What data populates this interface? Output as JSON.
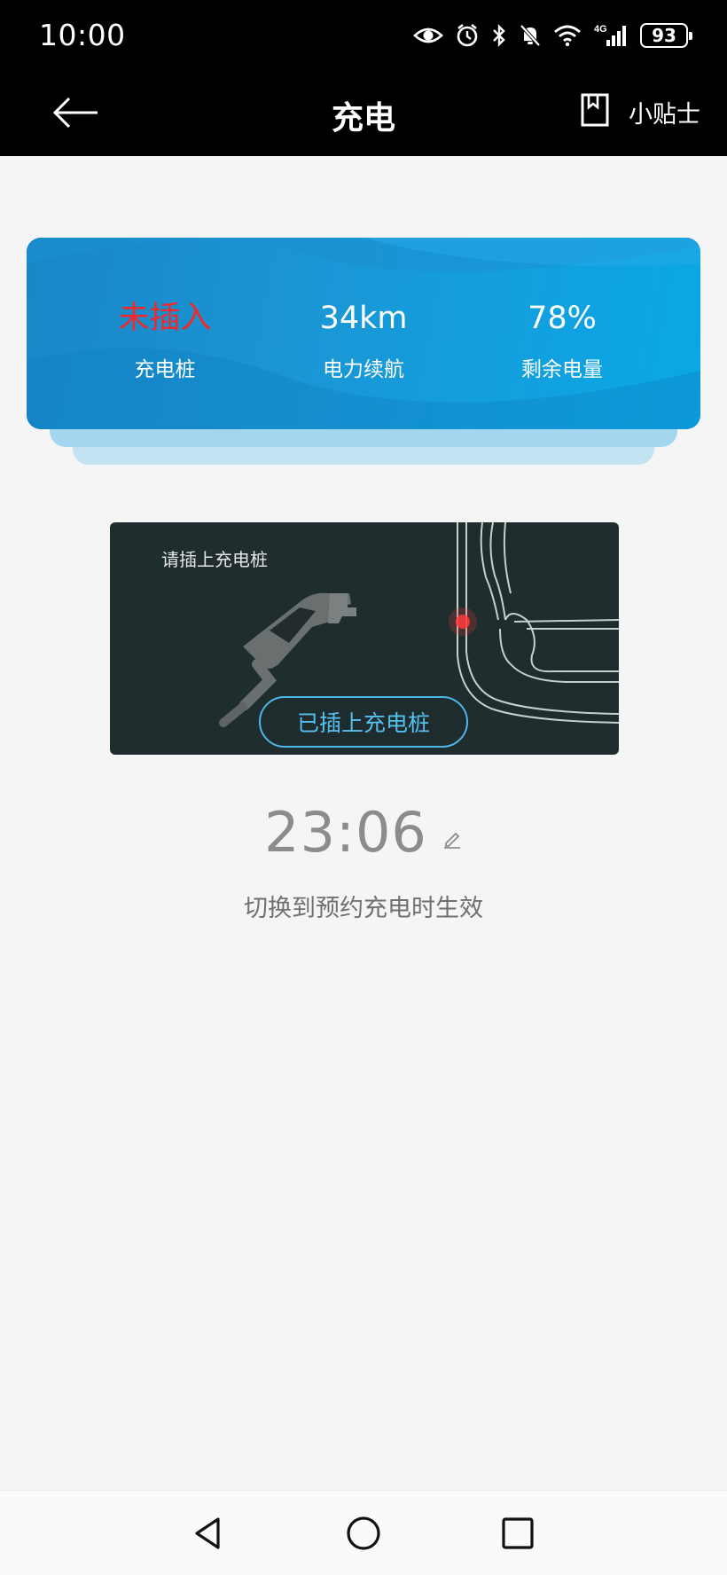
{
  "status_bar": {
    "time": "10:00",
    "battery": "93",
    "icons": [
      "eye-icon",
      "alarm-icon",
      "bluetooth-icon",
      "mute-bell-icon",
      "wifi-icon",
      "signal-4g-icon",
      "battery-icon"
    ]
  },
  "header": {
    "title": "充电",
    "back_icon": "arrow-left-icon",
    "tips_icon": "bookmark-icon",
    "tips_label": "小贴士"
  },
  "stats": [
    {
      "value": "未插入",
      "label": "充电桩",
      "color": "#ef2a2a"
    },
    {
      "value": "34km",
      "label": "电力续航",
      "color": "#ffffff"
    },
    {
      "value": "78%",
      "label": "剩余电量",
      "color": "#ffffff"
    }
  ],
  "illustration": {
    "prompt": "请插上充电桩",
    "button_label": "已插上充电桩",
    "accent": "#4fb7e8"
  },
  "schedule": {
    "time": "23:06",
    "note": "切换到预约充电时生效",
    "edit_icon": "pencil-icon"
  },
  "nav": {
    "back_icon": "triangle-back-icon",
    "home_icon": "circle-home-icon",
    "recents_icon": "square-recents-icon"
  },
  "colors": {
    "card_blue": "#1a97d6",
    "alert_red": "#ef2a2a",
    "background": "#f5f5f5"
  }
}
